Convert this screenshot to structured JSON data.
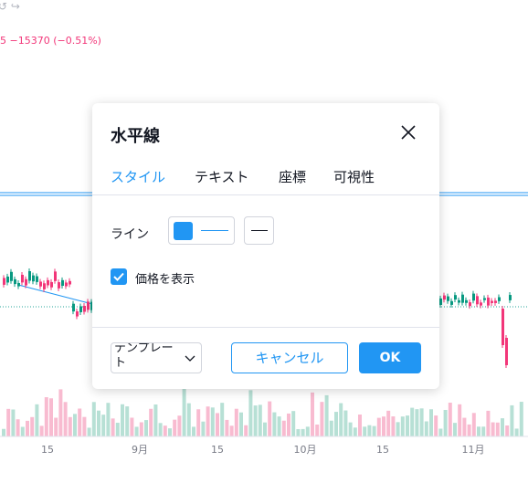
{
  "chart": {
    "topline": "↺ ↪",
    "price_change": "5  −15370 (−0.51%)",
    "x_ticks": [
      "15",
      "9月",
      "15",
      "10月",
      "15",
      "11月"
    ],
    "up_color": "#26a69a",
    "down_color": "#ef5350",
    "accent": "#2196f3"
  },
  "dialog": {
    "title": "水平線",
    "close_icon": "close-icon",
    "tabs": [
      "スタイル",
      "テキスト",
      "座標",
      "可視性"
    ],
    "active_tab": "スタイル",
    "line_label": "ライン",
    "line_color": "#2196f3",
    "show_price_label": "価格を表示",
    "show_price_checked": true,
    "template_label": "テンプレート",
    "cancel_label": "キャンセル",
    "ok_label": "OK"
  }
}
